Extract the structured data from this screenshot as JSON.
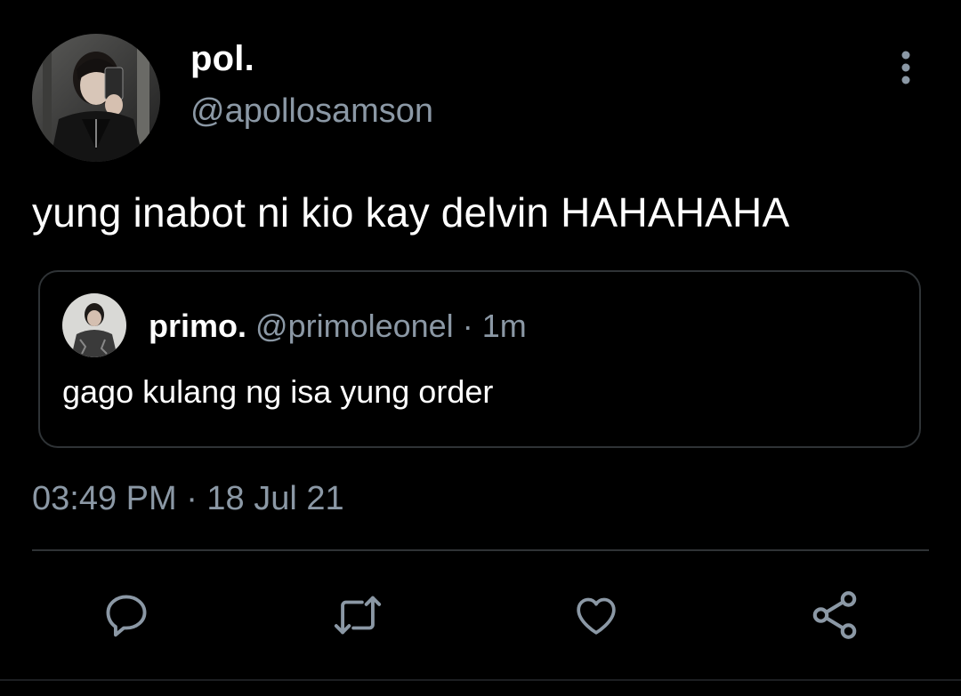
{
  "author": {
    "display_name": "pol.",
    "handle": "@apollosamson",
    "avatar_icon": "profile-photo"
  },
  "tweet": {
    "text": "yung inabot ni kio kay delvin HAHAHAHA",
    "timestamp": "03:49 PM · 18 Jul 21"
  },
  "quoted_tweet": {
    "display_name": "primo.",
    "handle": "@primoleonel",
    "separator": "·",
    "time": "1m",
    "text": "gago kulang ng isa yung order",
    "avatar_icon": "profile-photo"
  },
  "actions": [
    {
      "name": "reply",
      "icon": "reply-icon"
    },
    {
      "name": "retweet",
      "icon": "retweet-icon"
    },
    {
      "name": "like",
      "icon": "heart-icon"
    },
    {
      "name": "share",
      "icon": "share-icon"
    }
  ],
  "colors": {
    "background": "#000000",
    "text_primary": "#ffffff",
    "text_secondary": "#8b98a5",
    "border": "#2f3336"
  }
}
